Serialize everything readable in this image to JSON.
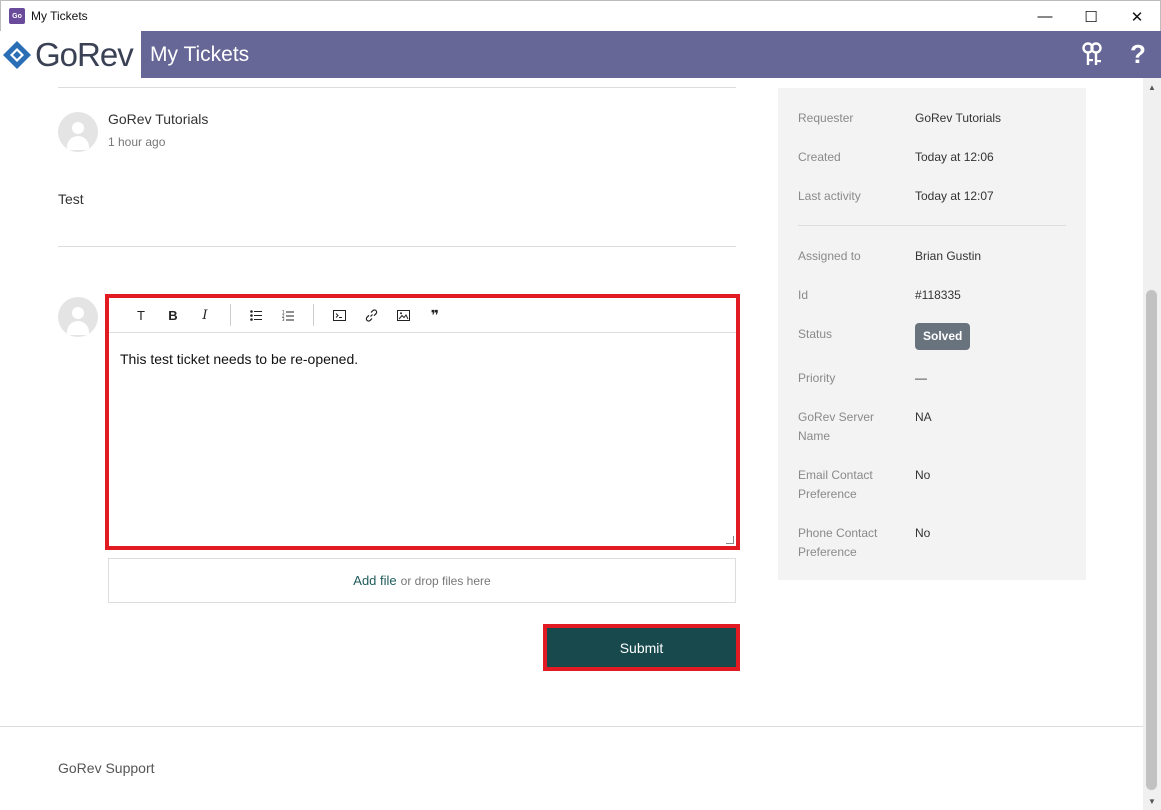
{
  "window": {
    "title": "My Tickets",
    "controls": {
      "minimize": "—",
      "maximize": "☐",
      "close": "✕"
    }
  },
  "app": {
    "logo_text": "GoRev",
    "page_title": "My Tickets",
    "header_icons": [
      "keys-icon",
      "help-icon"
    ],
    "help_glyph": "?"
  },
  "comment": {
    "author": "GoRev Tutorials",
    "time": "1 hour ago",
    "body": "Test"
  },
  "editor": {
    "toolbar": [
      "T",
      "B",
      "I",
      "bullet-list",
      "numbered-list",
      "code",
      "link",
      "image",
      "quote"
    ],
    "text": "This test ticket needs to be re-opened."
  },
  "upload": {
    "link": "Add file",
    "hint": "or drop files here"
  },
  "submit_label": "Submit",
  "details": [
    {
      "label": "Requester",
      "value": "GoRev Tutorials"
    },
    {
      "label": "Created",
      "value": "Today at 12:06"
    },
    {
      "label": "Last activity",
      "value": "Today at 12:07"
    },
    {
      "label": "Assigned to",
      "value": "Brian Gustin"
    },
    {
      "label": "Id",
      "value": "#118335"
    },
    {
      "label": "Status",
      "value": "Solved"
    },
    {
      "label": "Priority",
      "value": "—"
    },
    {
      "label": "GoRev Server Name",
      "value": "NA"
    },
    {
      "label": "Email Contact Preference",
      "value": "No"
    },
    {
      "label": "Phone Contact Preference",
      "value": "No"
    }
  ],
  "footer": "GoRev Support",
  "colors": {
    "header": "#666797",
    "submit": "#17494d",
    "highlight": "#e21b23",
    "badge": "#68737d"
  }
}
